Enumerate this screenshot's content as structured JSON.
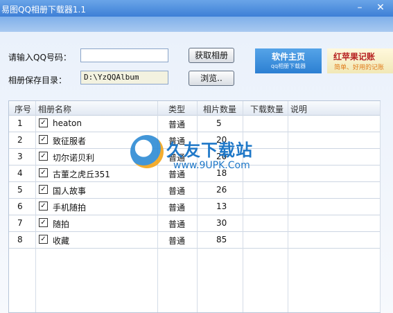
{
  "window": {
    "title": "易图QQ相册下载器1.1",
    "minimize": "–",
    "close": "✕"
  },
  "form": {
    "qq_label": "请输入QQ号码：",
    "qq_value": "",
    "dir_label": "相册保存目录：",
    "dir_value": "D:\\YzQQAlbum",
    "fetch_button": "获取相册",
    "browse_button": "浏览.."
  },
  "banners": {
    "left": {
      "title": "软件主页",
      "sub": "qq相册下载器"
    },
    "right": {
      "title": "红苹果记账",
      "sub": "简单、好用的记账"
    }
  },
  "table": {
    "headers": [
      "序号",
      "相册名称",
      "类型",
      "相片数量",
      "下载数量",
      "说明"
    ],
    "rows": [
      {
        "no": "1",
        "name": "heaton",
        "type": "普通",
        "count": "5"
      },
      {
        "no": "2",
        "name": "致征服者",
        "type": "普通",
        "count": "20"
      },
      {
        "no": "3",
        "name": "切尔诺贝利",
        "type": "普通",
        "count": "20"
      },
      {
        "no": "4",
        "name": "古董之虎丘351",
        "type": "普通",
        "count": "18"
      },
      {
        "no": "5",
        "name": "国人故事",
        "type": "普通",
        "count": "26"
      },
      {
        "no": "6",
        "name": "手机随拍",
        "type": "普通",
        "count": "13"
      },
      {
        "no": "7",
        "name": "随拍",
        "type": "普通",
        "count": "30"
      },
      {
        "no": "8",
        "name": "收藏",
        "type": "普通",
        "count": "85"
      }
    ]
  },
  "watermark": {
    "title": "久友下载站",
    "url": "www.9UPK.Com"
  }
}
